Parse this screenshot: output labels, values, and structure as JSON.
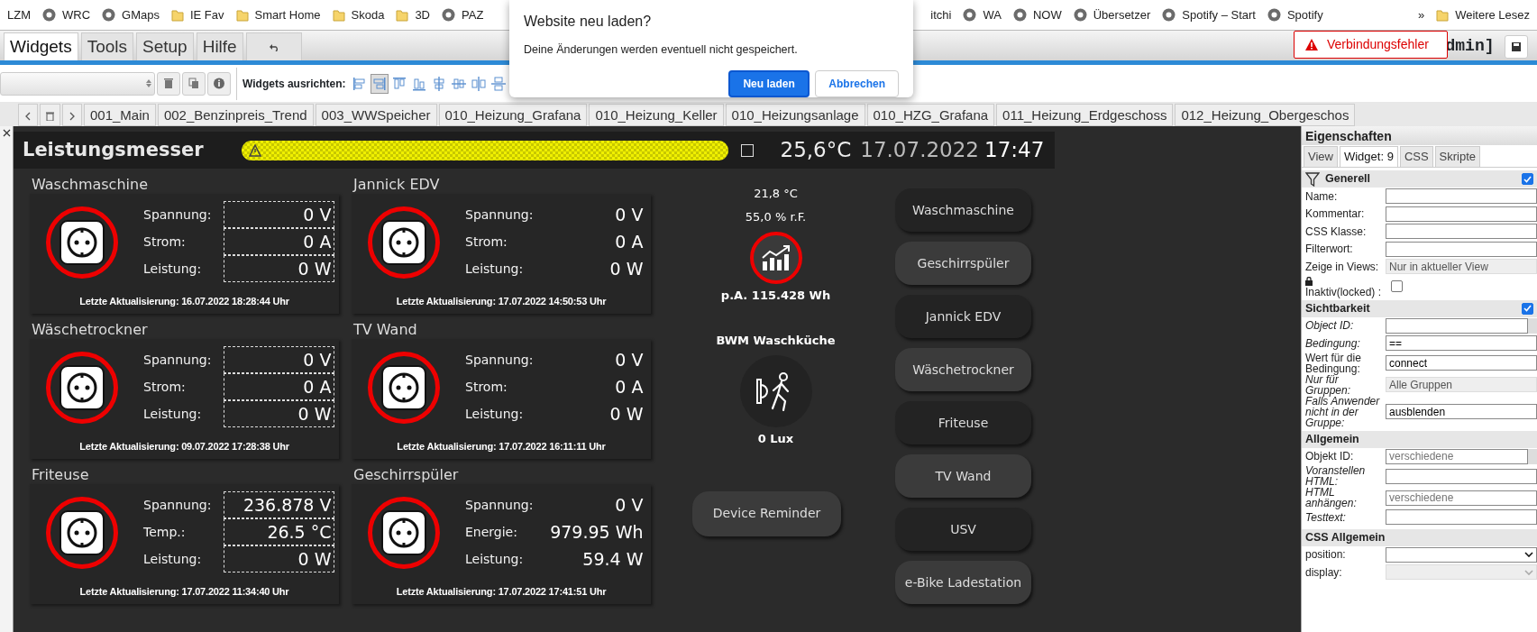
{
  "bookmarks": [
    {
      "label": "LZM",
      "kind": "plain"
    },
    {
      "label": "WRC",
      "kind": "site"
    },
    {
      "label": "GMaps",
      "kind": "site"
    },
    {
      "label": "IE Fav",
      "kind": "folder"
    },
    {
      "label": "Smart Home",
      "kind": "folder"
    },
    {
      "label": "Skoda",
      "kind": "folder"
    },
    {
      "label": "3D",
      "kind": "folder"
    },
    {
      "label": "PAZ",
      "kind": "site"
    }
  ],
  "bookmarks_right": [
    {
      "label": "itchi",
      "kind": "plain"
    },
    {
      "label": "WA",
      "kind": "site"
    },
    {
      "label": "NOW",
      "kind": "site"
    },
    {
      "label": "Übersetzer",
      "kind": "site"
    },
    {
      "label": "Spotify – Start",
      "kind": "site"
    },
    {
      "label": "Spotify",
      "kind": "site"
    }
  ],
  "bookmarks_overflow": "»",
  "bookmarks_folder": "Weitere Lesez",
  "menu_tabs": [
    {
      "label": "Widgets",
      "selected": true
    },
    {
      "label": "Tools",
      "selected": false
    },
    {
      "label": "Setup",
      "selected": false
    },
    {
      "label": "Hilfe",
      "selected": false
    }
  ],
  "user_label": "dmin]",
  "connection_error": "Verbindungsfehler",
  "toolbar": {
    "align_label": "Widgets ausrichten:",
    "align_buttons": [
      {
        "selected": false
      },
      {
        "selected": true
      },
      {
        "selected": false
      },
      {
        "selected": false
      },
      {
        "selected": false
      },
      {
        "selected": false
      },
      {
        "selected": false
      },
      {
        "selected": false
      }
    ]
  },
  "view_tabs": [
    "001_Main",
    "002_Benzinpreis_Trend",
    "003_WWSpeicher",
    "010_Heizung_Grafana",
    "010_Heizung_Keller",
    "010_Heizungsanlage",
    "010_HZG_Grafana",
    "011_Heizung_Erdgeschoss",
    "012_Heizung_Obergeschos"
  ],
  "dialog": {
    "title": "Website neu laden?",
    "message": "Deine Änderungen werden eventuell nicht gespeichert.",
    "buttons": [
      {
        "label": "Neu laden",
        "kind": "primary"
      },
      {
        "label": "Abbrechen",
        "kind": "secondary"
      }
    ]
  },
  "header": {
    "title": "Leistungsmesser",
    "checked": false,
    "temperature": "25,6°C",
    "date": "17.07.2022",
    "time": "17:47"
  },
  "devices": [
    {
      "title": "Waschmaschine",
      "selected": true,
      "rows": [
        {
          "label": "Spannung:",
          "value": "0 V"
        },
        {
          "label": "Strom:",
          "value": "0 A"
        },
        {
          "label": "Leistung:",
          "value": "0 W"
        }
      ],
      "updated": "Letzte Aktualisierung: 16.07.2022 18:28:44 Uhr"
    },
    {
      "title": "Jannick EDV",
      "selected": false,
      "rows": [
        {
          "label": "Spannung:",
          "value": "0 V"
        },
        {
          "label": "Strom:",
          "value": "0 A"
        },
        {
          "label": "Leistung:",
          "value": "0 W"
        }
      ],
      "updated": "Letzte Aktualisierung: 17.07.2022 14:50:53 Uhr"
    },
    {
      "title": "Wäschetrockner",
      "selected": true,
      "rows": [
        {
          "label": "Spannung:",
          "value": "0 V"
        },
        {
          "label": "Strom:",
          "value": "0 A"
        },
        {
          "label": "Leistung:",
          "value": "0 W"
        }
      ],
      "updated": "Letzte Aktualisierung: 09.07.2022 17:28:38 Uhr"
    },
    {
      "title": "TV Wand",
      "selected": false,
      "rows": [
        {
          "label": "Spannung:",
          "value": "0 V"
        },
        {
          "label": "Strom:",
          "value": "0 A"
        },
        {
          "label": "Leistung:",
          "value": "0 W"
        }
      ],
      "updated": "Letzte Aktualisierung: 17.07.2022 16:11:11 Uhr"
    },
    {
      "title": "Friteuse",
      "selected": true,
      "rows": [
        {
          "label": "Spannung:",
          "value": "236.878 V"
        },
        {
          "label": "Temp.:",
          "value": "26.5 °C"
        },
        {
          "label": "Leistung:",
          "value": "0 W"
        }
      ],
      "updated": "Letzte Aktualisierung: 17.07.2022 11:34:40 Uhr"
    },
    {
      "title": "Geschirrspüler",
      "selected": false,
      "rows": [
        {
          "label": "Spannung:",
          "value": "0 V"
        },
        {
          "label": "Energie:",
          "value": "979.95 Wh"
        },
        {
          "label": "Leistung:",
          "value": "59.4 W"
        }
      ],
      "updated": "Letzte Aktualisierung: 17.07.2022 17:41:51 Uhr"
    }
  ],
  "climate": {
    "temperature": "21,8 °C",
    "humidity": "55,0 % r.F.",
    "energy": "p.A. 115.428 Wh",
    "motion_title": "BWM Waschküche",
    "lux": "0 Lux",
    "reminder_button": "Device Reminder"
  },
  "device_buttons": [
    {
      "label": "Waschmaschine",
      "highlighted": false
    },
    {
      "label": "Geschirrspüler",
      "highlighted": true
    },
    {
      "label": "Jannick EDV",
      "highlighted": false
    },
    {
      "label": "Wäschetrockner",
      "highlighted": true
    },
    {
      "label": "Friteuse",
      "highlighted": false
    },
    {
      "label": "TV Wand",
      "highlighted": true
    },
    {
      "label": "USV",
      "highlighted": false
    },
    {
      "label": "e-Bike Ladestation",
      "highlighted": true
    }
  ],
  "properties": {
    "title": "Eigenschaften",
    "tabs": [
      {
        "label": "View",
        "selected": false
      },
      {
        "label": "Widget: 9",
        "selected": true
      },
      {
        "label": "CSS",
        "selected": false
      },
      {
        "label": "Skripte",
        "selected": false
      }
    ],
    "sections": [
      {
        "title": "Generell",
        "kind": "filter",
        "checked": true,
        "fields": [
          {
            "label": "Name:",
            "kind": "text",
            "italic": false
          },
          {
            "label": "Kommentar:",
            "kind": "text",
            "italic": false
          },
          {
            "label": "CSS Klasse:",
            "kind": "text",
            "italic": false
          },
          {
            "label": "Filterwort:",
            "kind": "text",
            "italic": false
          },
          {
            "label": "Zeige in Views:",
            "kind": "select",
            "italic": false,
            "value": "Nur in aktueller View"
          },
          {
            "label": "Inaktiv(locked) :",
            "kind": "checkbox",
            "italic": false,
            "checked": false
          }
        ]
      },
      {
        "title": "Sichtbarkeit",
        "kind": "plain",
        "checked": true,
        "fields": [
          {
            "label": "Object ID:",
            "kind": "id",
            "italic": true
          },
          {
            "label": "Bedingung:",
            "kind": "text",
            "italic": true,
            "value": "=="
          },
          {
            "label": "Wert für die Bedingung:",
            "kind": "text",
            "italic": false,
            "value": "connect"
          },
          {
            "label": "Nur für Gruppen:",
            "kind": "select",
            "italic": true,
            "value": "Alle Gruppen"
          },
          {
            "label": "Falls Anwender nicht in der Gruppe:",
            "kind": "text",
            "italic": true,
            "value": "ausblenden"
          }
        ]
      },
      {
        "title": "Allgemein",
        "kind": "plain",
        "fields": [
          {
            "label": "Objekt ID:",
            "kind": "id",
            "italic": false,
            "placeholder": "verschiedene"
          },
          {
            "label": "Voranstellen HTML:",
            "kind": "text",
            "italic": true
          },
          {
            "label": "HTML anhängen:",
            "kind": "text",
            "italic": true,
            "placeholder": "verschiedene"
          },
          {
            "label": "Testtext:",
            "kind": "text",
            "italic": true
          }
        ]
      },
      {
        "title": "CSS Allgemein",
        "kind": "plain",
        "fields": [
          {
            "label": "position:",
            "kind": "dropdown",
            "italic": false
          },
          {
            "label": "display:",
            "kind": "dropdown-disabled",
            "italic": false
          }
        ]
      }
    ]
  }
}
